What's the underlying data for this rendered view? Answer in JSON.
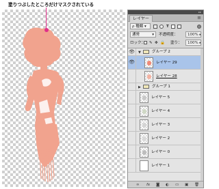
{
  "annotation": {
    "caption": "塗りつぶしたところだけマスクされている"
  },
  "colors": {
    "figure": "#f1a38e",
    "accent": "#e0308a",
    "selected_row": "#a9c4ea",
    "layer_thumb_mark": "#f08a78"
  },
  "panel": {
    "tab": "レイヤー",
    "menu_icon": "panel-menu-icon",
    "filter": {
      "kind": "種類",
      "icons": [
        "image-filter-icon",
        "adjustment-filter-icon",
        "text-filter-icon",
        "shape-filter-icon",
        "smart-filter-icon"
      ]
    },
    "blend": {
      "mode": "通常",
      "opacity_label": "不透明度：",
      "opacity": "100%"
    },
    "lock": {
      "label": "ロック：",
      "fill_label": "塗り：",
      "fill": "100%"
    },
    "layers": [
      {
        "name": "グループ 2",
        "type": "group",
        "visible": true,
        "expanded": true,
        "selected": false
      },
      {
        "name": "レイヤー 29",
        "type": "layer",
        "visible": true,
        "selected": true,
        "clipped": false
      },
      {
        "name": "レイヤー 28",
        "type": "layer",
        "visible": false,
        "selected": false,
        "clipped": false
      },
      {
        "name": "グループ 1",
        "type": "group",
        "visible": false,
        "expanded": false,
        "selected": false
      },
      {
        "name": "レイヤー 5",
        "type": "layer",
        "visible": false,
        "selected": false
      },
      {
        "name": "レイヤー 4",
        "type": "layer",
        "visible": false,
        "selected": false
      },
      {
        "name": "レイヤー 3",
        "type": "layer",
        "visible": false,
        "selected": false
      },
      {
        "name": "レイヤー 2",
        "type": "layer",
        "visible": false,
        "selected": false
      },
      {
        "name": "レイヤー 0",
        "type": "layer",
        "visible": false,
        "selected": false
      },
      {
        "name": "レイヤー 1",
        "type": "layer",
        "visible": false,
        "selected": false
      }
    ],
    "bottom": {
      "link": "link-layers-icon",
      "fx": "fx",
      "mask": "add-mask-icon",
      "adjust": "adjustment-layer-icon",
      "group": "new-group-icon",
      "new": "new-layer-icon",
      "trash": "trash-icon"
    }
  }
}
